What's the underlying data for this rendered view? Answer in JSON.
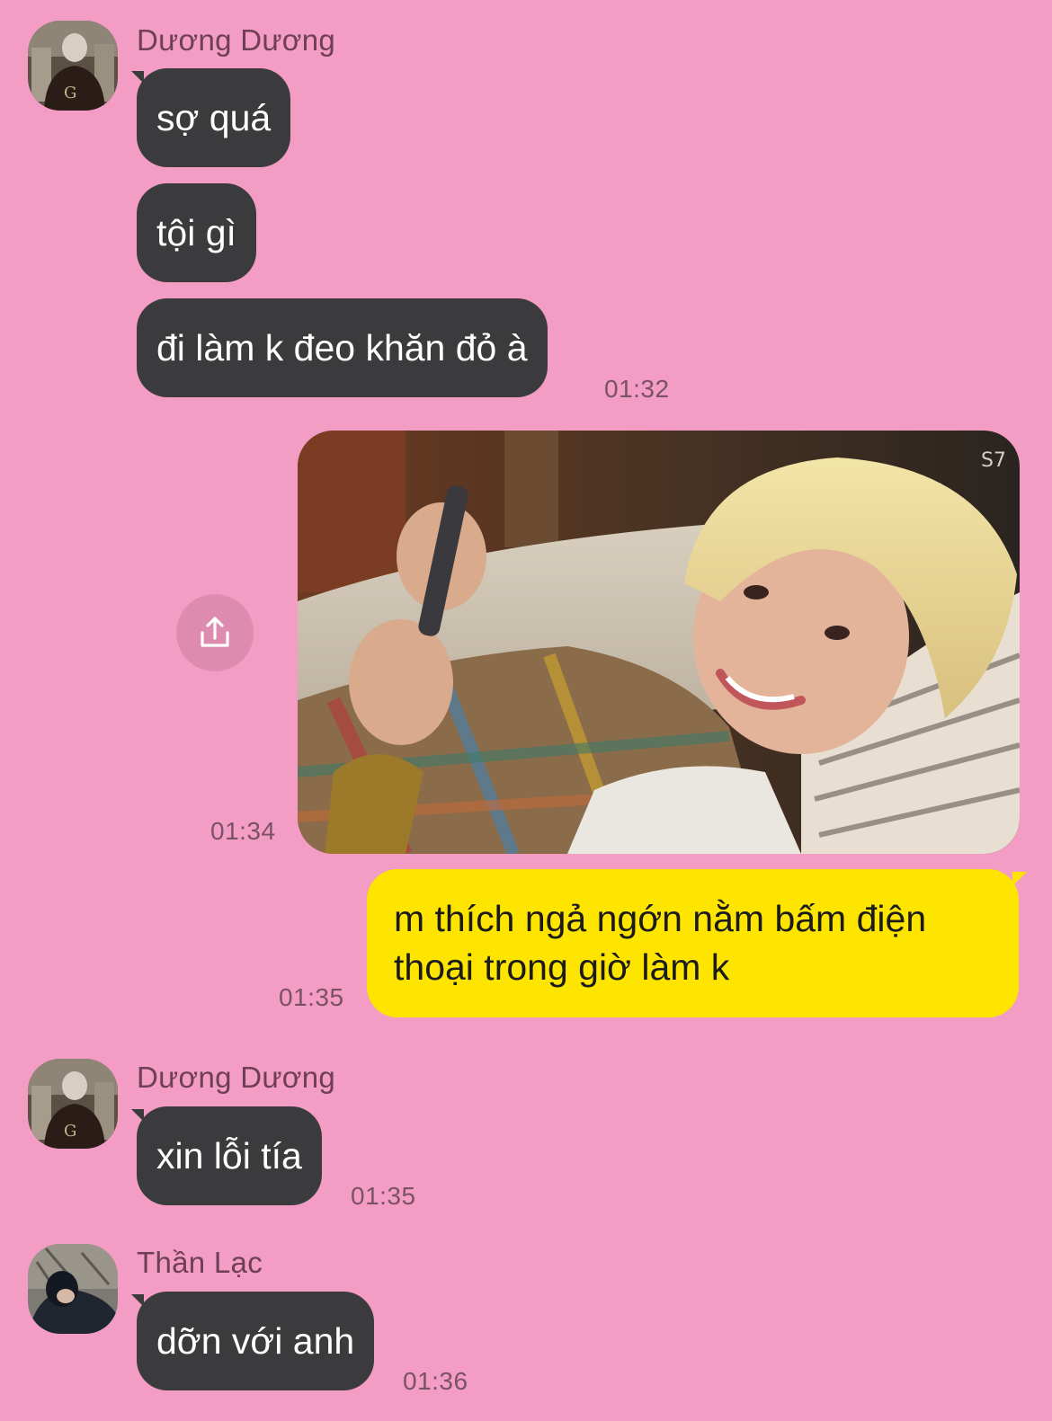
{
  "messages": [
    {
      "sender": "Dương Dương",
      "bubbles": [
        "sợ quá",
        "tội gì",
        "đi làm k đeo khăn đỏ à"
      ],
      "time": "01:32"
    },
    {
      "outgoing_image_time": "01:34",
      "image_watermark": "S7"
    },
    {
      "outgoing_text": "m thích ngả ngớn nằm bấm điện thoại trong giờ làm k",
      "time": "01:35"
    },
    {
      "sender": "Dương Dương",
      "bubbles": [
        "xin lỗi tía"
      ],
      "time": "01:35"
    },
    {
      "sender": "Thần Lạc",
      "bubbles": [
        "dỡn với anh"
      ],
      "time": "01:36"
    }
  ],
  "colors": {
    "background": "#f39cc4",
    "incoming_bubble": "#3b3b3d",
    "outgoing_bubble": "#fee500"
  },
  "icons": {
    "share": "share-upload-icon"
  }
}
